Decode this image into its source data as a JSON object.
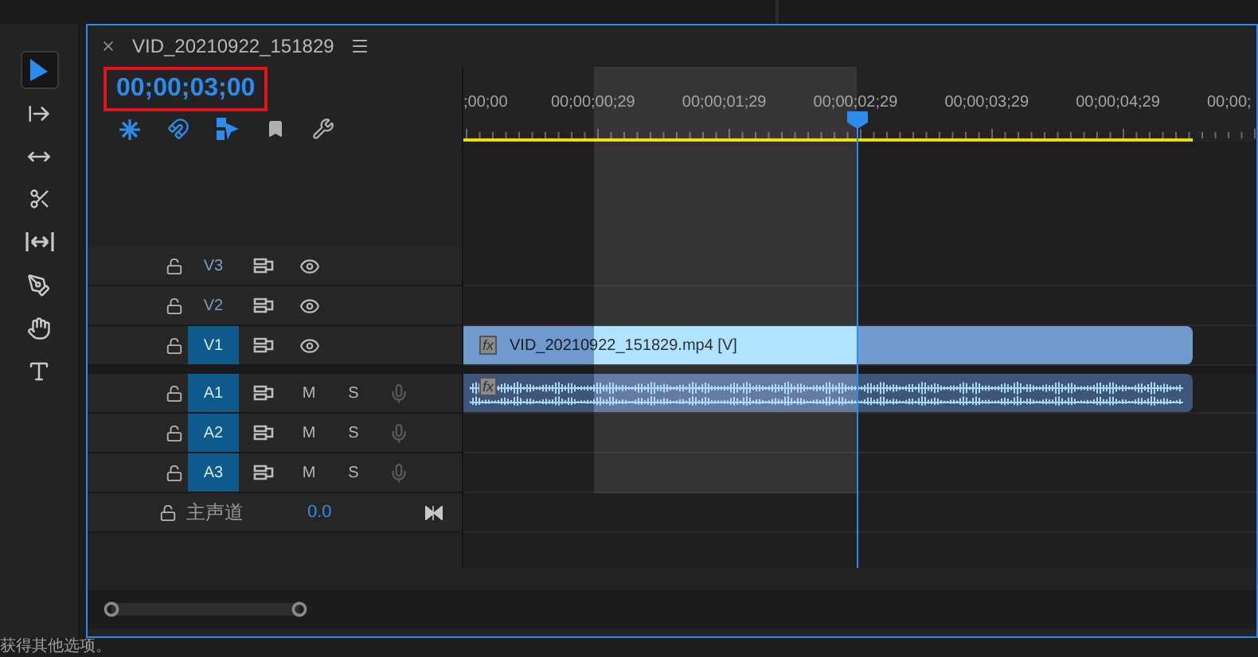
{
  "tools": [
    {
      "kind": "select",
      "selected": true
    },
    {
      "kind": "track-select",
      "selected": false
    },
    {
      "kind": "ripple",
      "selected": false
    },
    {
      "kind": "razor",
      "selected": false
    },
    {
      "kind": "slip",
      "selected": false
    },
    {
      "kind": "pen",
      "selected": false
    },
    {
      "kind": "hand",
      "selected": false
    },
    {
      "kind": "type",
      "selected": false
    }
  ],
  "panel": {
    "title": "VID_20210922_151829",
    "timecode": "00;00;03;00"
  },
  "timeline_tools": [
    {
      "kind": "nest",
      "on": true
    },
    {
      "kind": "snap",
      "on": true
    },
    {
      "kind": "linked",
      "on": true
    },
    {
      "kind": "marker",
      "on": false
    },
    {
      "kind": "settings",
      "on": false
    }
  ],
  "ruler": {
    "labels": [
      ";00;00",
      "00;00;00;29",
      "00;00;01;29",
      "00;00;02;29",
      "00;00;03;29",
      "00;00;04;29",
      "00;00;"
    ]
  },
  "tracks": [
    {
      "kind": "video",
      "name": "V3",
      "targeted": false
    },
    {
      "kind": "video",
      "name": "V2",
      "targeted": false
    },
    {
      "kind": "video",
      "name": "V1",
      "targeted": true
    },
    {
      "kind": "audio",
      "name": "A1",
      "targeted": true,
      "mute": "M",
      "solo": "S"
    },
    {
      "kind": "audio",
      "name": "A2",
      "targeted": true,
      "mute": "M",
      "solo": "S"
    },
    {
      "kind": "audio",
      "name": "A3",
      "targeted": true,
      "mute": "M",
      "solo": "S"
    }
  ],
  "master": {
    "name": "主声道",
    "value": "0.0"
  },
  "clips": [
    {
      "kind": "video",
      "name": "VID_20210922_151829.mp4 [V]",
      "badge": "fx"
    },
    {
      "kind": "audio",
      "badge": "fx"
    }
  ],
  "status_text": "获得其他选项。"
}
